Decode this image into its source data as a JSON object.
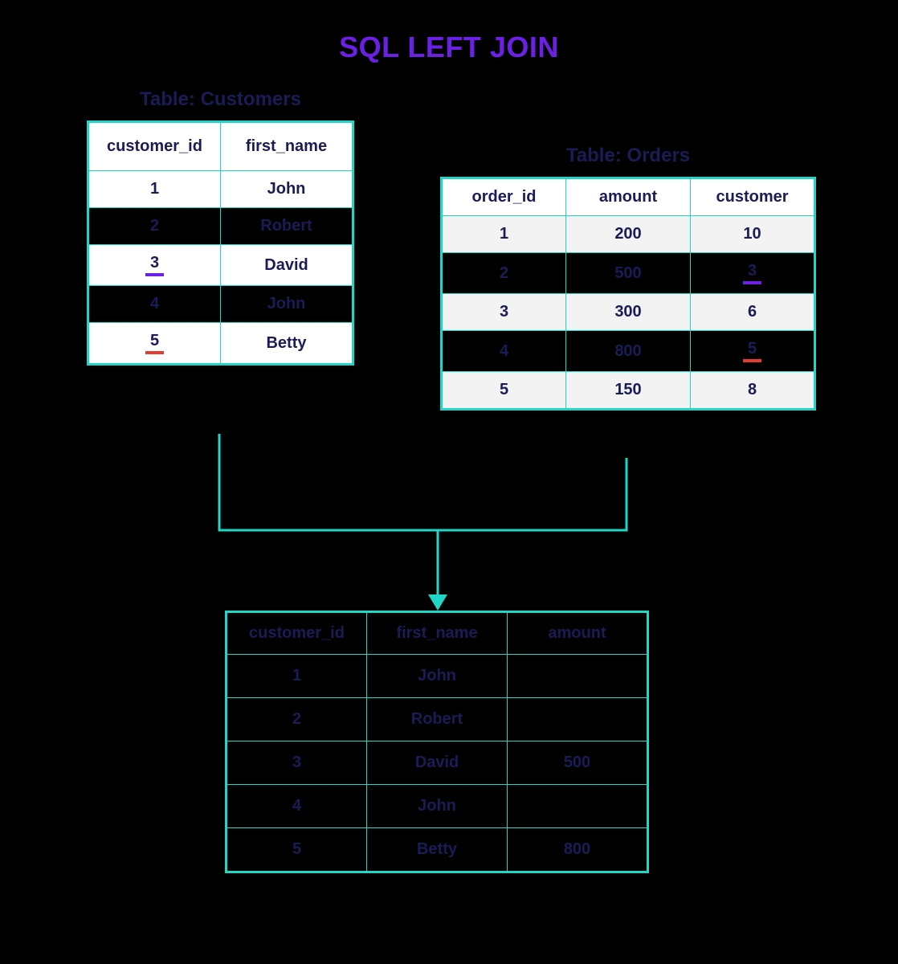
{
  "title": "SQL LEFT JOIN",
  "customers": {
    "label": "Table: Customers",
    "headers": [
      "customer_id",
      "first_name"
    ],
    "rows": [
      {
        "id": "1",
        "name": "John",
        "hl": ""
      },
      {
        "id": "2",
        "name": "Robert",
        "hl": ""
      },
      {
        "id": "3",
        "name": "David",
        "hl": "purple"
      },
      {
        "id": "4",
        "name": "John",
        "hl": ""
      },
      {
        "id": "5",
        "name": "Betty",
        "hl": "red"
      }
    ]
  },
  "orders": {
    "label": "Table: Orders",
    "headers": [
      "order_id",
      "amount",
      "customer"
    ],
    "rows": [
      {
        "id": "1",
        "amount": "200",
        "customer": "10",
        "hl": ""
      },
      {
        "id": "2",
        "amount": "500",
        "customer": "3",
        "hl": "purple"
      },
      {
        "id": "3",
        "amount": "300",
        "customer": "6",
        "hl": ""
      },
      {
        "id": "4",
        "amount": "800",
        "customer": "5",
        "hl": "red"
      },
      {
        "id": "5",
        "amount": "150",
        "customer": "8",
        "hl": ""
      }
    ]
  },
  "result": {
    "headers": [
      "customer_id",
      "first_name",
      "amount"
    ],
    "rows": [
      {
        "id": "1",
        "name": "John",
        "amount": ""
      },
      {
        "id": "2",
        "name": "Robert",
        "amount": ""
      },
      {
        "id": "3",
        "name": "David",
        "amount": "500"
      },
      {
        "id": "4",
        "name": "John",
        "amount": ""
      },
      {
        "id": "5",
        "name": "Betty",
        "amount": "800"
      }
    ]
  }
}
